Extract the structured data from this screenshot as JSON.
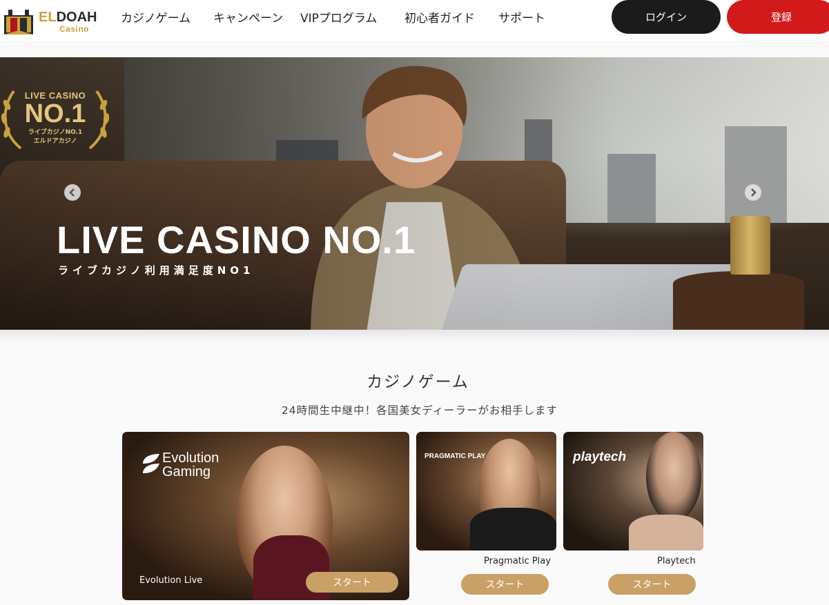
{
  "brand": {
    "logo_top_el": "EL",
    "logo_top_doah": "DOAH",
    "logo_bottom": "Casino"
  },
  "nav": {
    "items": [
      "カジノゲーム",
      "キャンペーン",
      "VIPプログラム",
      "初心者ガイド",
      "サポート"
    ],
    "login_label": "ログイン",
    "register_label": "登録"
  },
  "hero": {
    "badge_line1": "LIVE CASINO",
    "badge_line2": "NO.1",
    "badge_line3": "ライブカジノNO.1",
    "badge_line4": "エルドアカジノ",
    "title": "LIVE CASINO NO.1",
    "subtitle": "ライブカジノ利用満足度NO1"
  },
  "section": {
    "title": "カジノゲーム",
    "subtitle": "24時間生中継中！各国美女ディーラーがお相手します"
  },
  "providers": [
    {
      "logo_line1": "Evolution",
      "logo_line2": "Gaming",
      "label": "Evolution Live",
      "button": "スタート"
    },
    {
      "logo": "PRAGMATIC PLAY",
      "label": "Pragmatic Play",
      "button": "スタート"
    },
    {
      "logo": "playtech",
      "label": "Playtech",
      "button": "スタート"
    }
  ],
  "colors": {
    "register": "#d21a1a",
    "login": "#1b1b1b",
    "gold": "#c9a066"
  }
}
